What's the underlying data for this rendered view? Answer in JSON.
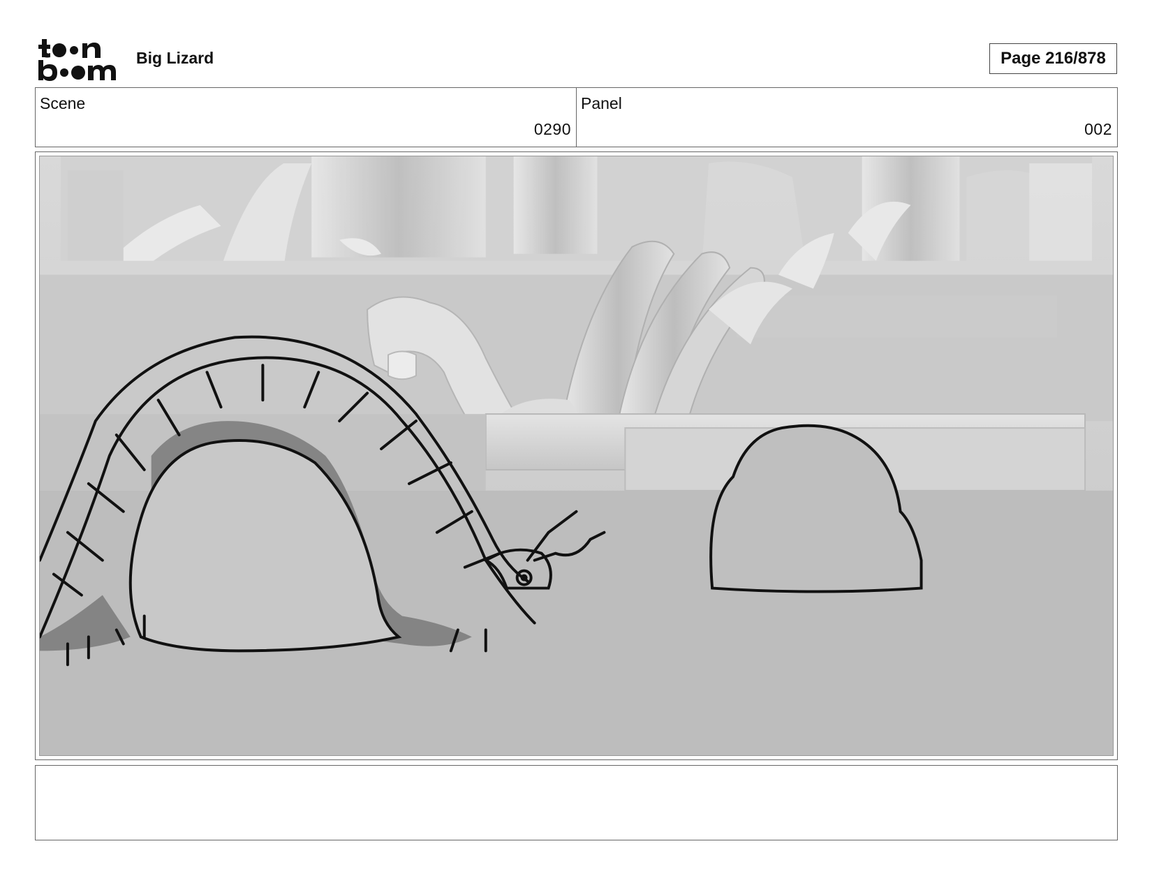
{
  "header": {
    "logo_text": "toon boom",
    "project_title": "Big Lizard",
    "page_indicator": "Page 216/878"
  },
  "scene": {
    "label": "Scene",
    "value": "0290"
  },
  "panel": {
    "label": "Panel",
    "value": "002"
  },
  "notes": {
    "text": ""
  }
}
